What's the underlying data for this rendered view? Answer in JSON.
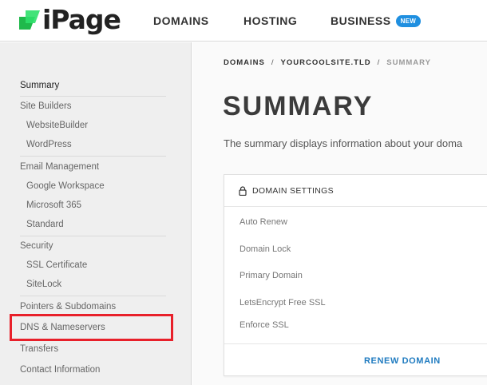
{
  "brand": {
    "name": "iPage",
    "color": "#1fb94b"
  },
  "nav": {
    "items": [
      {
        "label": "DOMAINS"
      },
      {
        "label": "HOSTING"
      },
      {
        "label": "BUSINESS",
        "badge": "NEW"
      }
    ],
    "badge_color": "#1f8fe0"
  },
  "sidebar": {
    "items": [
      {
        "label": "Summary",
        "level": 0,
        "active": true
      },
      {
        "label": "Site Builders",
        "level": 0
      },
      {
        "label": "WebsiteBuilder",
        "level": 1
      },
      {
        "label": "WordPress",
        "level": 1
      },
      {
        "label": "Email Management",
        "level": 0
      },
      {
        "label": "Google Workspace",
        "level": 1
      },
      {
        "label": "Microsoft 365",
        "level": 1
      },
      {
        "label": "Standard",
        "level": 1
      },
      {
        "label": "Security",
        "level": 0
      },
      {
        "label": "SSL Certificate",
        "level": 1
      },
      {
        "label": "SiteLock",
        "level": 1
      },
      {
        "label": "Pointers & Subdomains",
        "level": 0
      },
      {
        "label": "DNS & Nameservers",
        "level": 0,
        "highlighted": true
      },
      {
        "label": "Transfers",
        "level": 0
      },
      {
        "label": "Contact Information",
        "level": 0
      }
    ],
    "highlight_color": "#e8202a"
  },
  "breadcrumb": {
    "items": [
      "DOMAINS",
      "YOURCOOLSITE.TLD",
      "SUMMARY"
    ],
    "separator": "/"
  },
  "page": {
    "title": "SUMMARY",
    "description": "The summary displays information about your doma"
  },
  "domain_settings": {
    "header": "DOMAIN SETTINGS",
    "header_icon": "lock-icon",
    "rows": [
      "Auto Renew",
      "Domain Lock",
      "Primary Domain",
      "LetsEncrypt Free SSL",
      "Enforce SSL"
    ],
    "action_label": "RENEW DOMAIN",
    "action_color": "#1f7bc0"
  }
}
